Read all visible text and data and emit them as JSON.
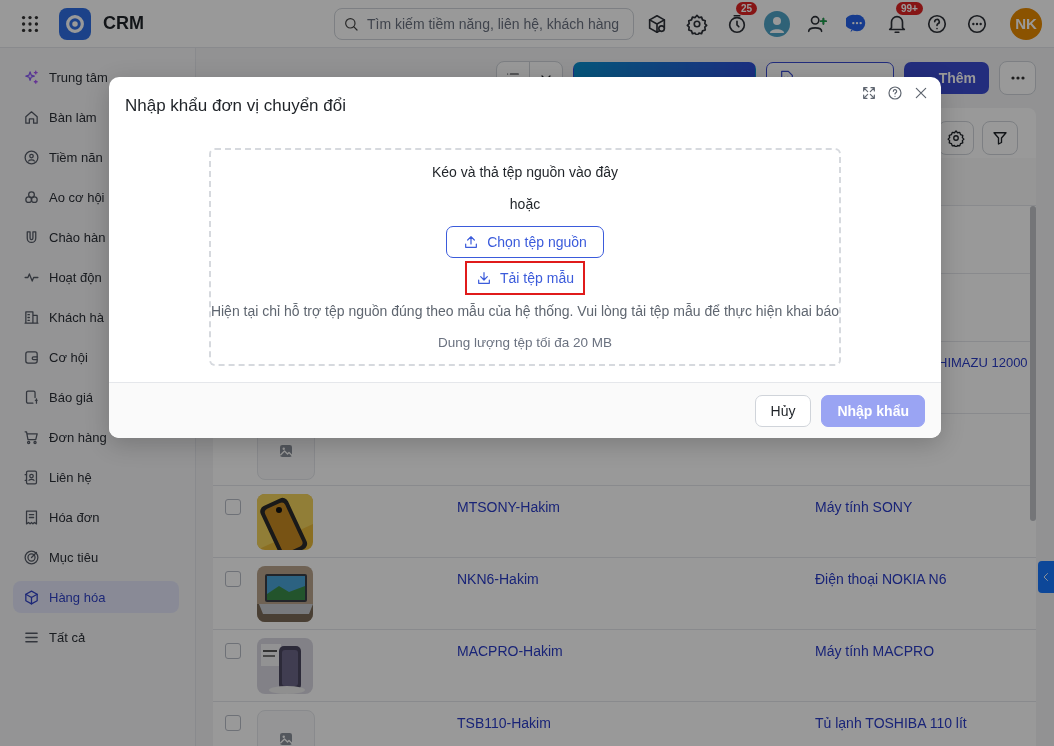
{
  "topbar": {
    "app_name": "CRM",
    "search": {
      "placeholder": "Tìm kiếm tiềm năng, liên hệ, khách hàng"
    },
    "timer_badge": "25",
    "notification_badge": "99+",
    "user_initials": "NK"
  },
  "sidebar": {
    "items": [
      {
        "label": "Trung tâm",
        "kind": "sparkle",
        "selected": false
      },
      {
        "label": "Bàn làm",
        "kind": "home",
        "selected": false
      },
      {
        "label": "Tiềm năn",
        "kind": "lead",
        "selected": false
      },
      {
        "label": "Ao cơ hội",
        "kind": "circles",
        "selected": false
      },
      {
        "label": "Chào hàn",
        "kind": "magnet",
        "selected": false
      },
      {
        "label": "Hoạt độn",
        "kind": "pulse",
        "selected": false
      },
      {
        "label": "Khách hà",
        "kind": "building",
        "selected": false
      },
      {
        "label": "Cơ hội",
        "kind": "wallet",
        "selected": false
      },
      {
        "label": "Báo giá",
        "kind": "quote",
        "selected": false
      },
      {
        "label": "Đơn hàng",
        "kind": "cart",
        "selected": false
      },
      {
        "label": "Liên hệ",
        "kind": "contact",
        "selected": false
      },
      {
        "label": "Hóa đơn",
        "kind": "invoice",
        "selected": false
      },
      {
        "label": "Mục tiêu",
        "kind": "target",
        "selected": false
      },
      {
        "label": "Hàng hóa",
        "kind": "cube",
        "selected": true
      },
      {
        "label": "Tất cả",
        "kind": "lines",
        "selected": false
      }
    ]
  },
  "page": {
    "buttons": [
      {
        "kind": "gradient"
      },
      {
        "kind": "outline"
      },
      {
        "label": "Thêm",
        "kind": "primary"
      }
    ]
  },
  "table": {
    "rows": [
      {
        "name": "HIMAZU 12000",
        "kind": "text"
      },
      {
        "kind": "placeholder"
      },
      {
        "code": "MTSONY-Hakim",
        "name": "Máy tính SONY",
        "kind": "phone",
        "checked": false
      },
      {
        "code": "NKN6-Hakim",
        "name": "Điện thoại NOKIA N6",
        "kind": "laptop",
        "checked": false
      },
      {
        "code": "MACPRO-Hakim",
        "name": "Máy tính MACPRO",
        "kind": "case",
        "checked": false
      },
      {
        "code": "TSB110-Hakim",
        "name": "Tủ lạnh TOSHIBA 110 lít",
        "kind": "placeholder",
        "checked": false
      }
    ]
  },
  "dialog": {
    "title": "Nhập khẩu đơn vị chuyển đổi",
    "drop_text": "Kéo và thả tệp nguồn vào đây",
    "or_text": "hoặc",
    "choose_button": "Chọn tệp nguồn",
    "template_link": {
      "label": "Tải tệp mẫu",
      "highlighted": true
    },
    "note": "Hiện tại chỉ hỗ trợ tệp nguồn đúng theo mẫu của hệ thống. Vui lòng tải tệp mẫu để thực hiện khai báo",
    "size_limit": "Dung lượng tệp tối đa 20 MB",
    "buttons": [
      {
        "label": "Hủy",
        "kind": "secondary",
        "disabled": false
      },
      {
        "label": "Nhập khẩu",
        "kind": "primary",
        "disabled": true
      }
    ]
  }
}
